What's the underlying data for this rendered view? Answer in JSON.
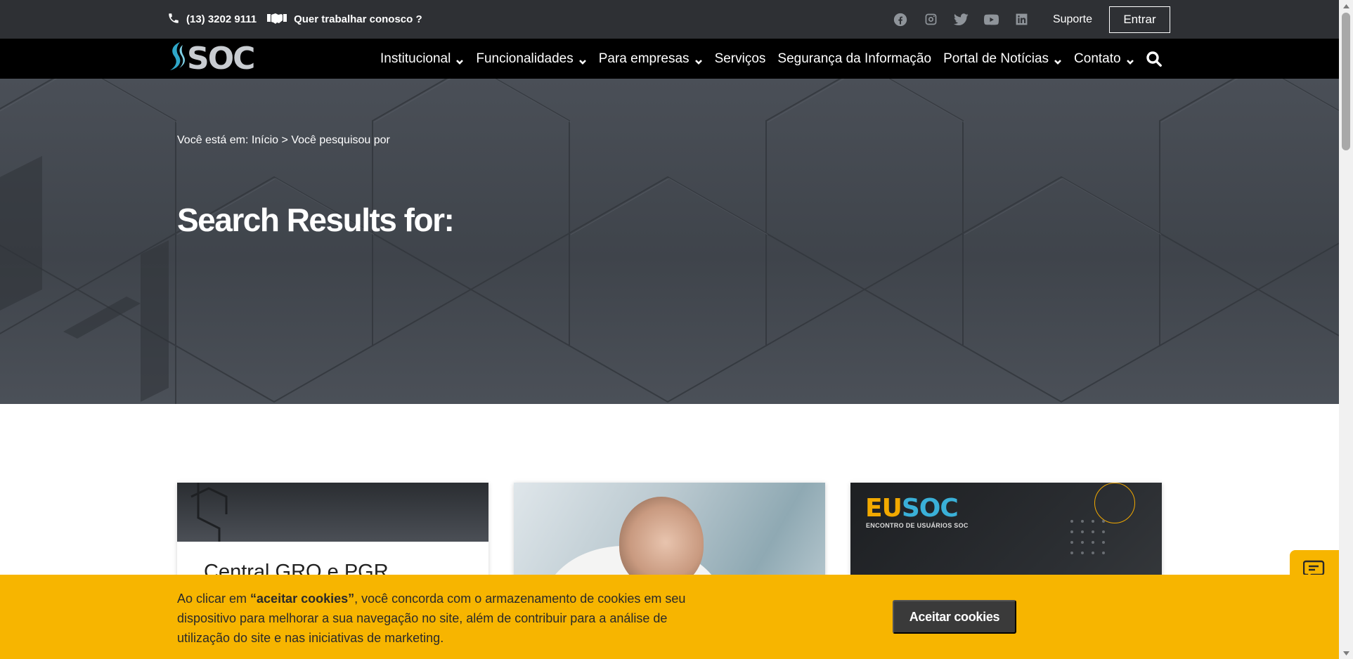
{
  "topbar": {
    "phone": "(13) 3202 9111",
    "careers": "Quer trabalhar conosco ?",
    "social": [
      "facebook-icon",
      "instagram-icon",
      "twitter-icon",
      "youtube-icon",
      "linkedin-icon"
    ],
    "support": "Suporte",
    "login": "Entrar"
  },
  "nav": {
    "logo": "SOC",
    "items": [
      {
        "label": "Institucional",
        "dropdown": true
      },
      {
        "label": "Funcionalidades",
        "dropdown": true
      },
      {
        "label": "Para empresas",
        "dropdown": true
      },
      {
        "label": "Serviços",
        "dropdown": false
      },
      {
        "label": "Segurança da Informação",
        "dropdown": false
      },
      {
        "label": "Portal de Notícias",
        "dropdown": true
      },
      {
        "label": "Contato",
        "dropdown": true
      }
    ]
  },
  "hero": {
    "breadcrumb": "Você está em: Início > Você pesquisou por",
    "title": "Search Results for:"
  },
  "cards": [
    {
      "title": "Central GRO e PGR"
    },
    {
      "title": ""
    },
    {
      "title": "",
      "logo_eu": "EU",
      "logo_soc": "SOC",
      "logo_sub": "ENCONTRO DE USUÁRIOS SOC"
    }
  ],
  "cookie": {
    "text_pre": "Ao clicar em ",
    "text_bold": "“aceitar cookies”",
    "text_post": ", você concorda com o armazenamento de cookies em seu dispositivo para melhorar a sua navegação no site, além de contribuir para a análise de utilização do site e nas iniciativas de marketing.",
    "button": "Aceitar cookies"
  },
  "colors": {
    "topbar": "#2e3034",
    "nav": "#000000",
    "accent": "#f7b500",
    "button_dark": "#3a3a3a"
  }
}
